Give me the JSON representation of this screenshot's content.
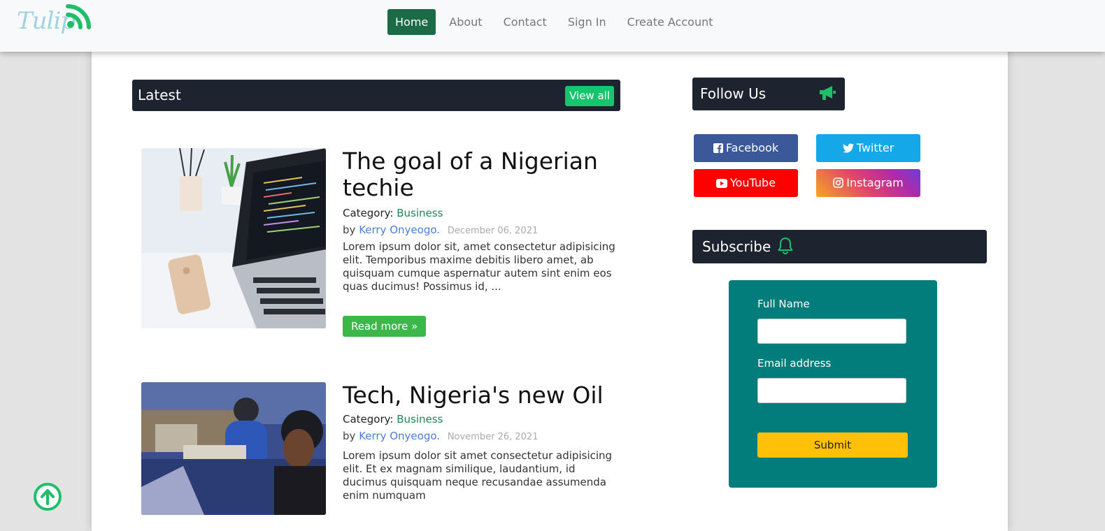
{
  "header": {
    "logo_text": "Tulip",
    "nav": [
      {
        "label": "Home",
        "active": true
      },
      {
        "label": "About",
        "active": false
      },
      {
        "label": "Contact",
        "active": false
      },
      {
        "label": "Sign In",
        "active": false
      },
      {
        "label": "Create Account",
        "active": false
      }
    ]
  },
  "latest": {
    "title": "Latest",
    "view_all": "View all"
  },
  "posts": [
    {
      "title": "The goal of a Nigerian techie",
      "category_label": "Category:",
      "category": "Business",
      "by": "by",
      "author": "Kerry Onyeogo.",
      "date": "December 06, 2021",
      "excerpt": "Lorem ipsum dolor sit, amet consectetur adipisicing elit. Temporibus maxime debitis libero amet, ab quisquam cumque aspernatur autem sint enim eos quas ducimus! Possimus id, ...",
      "read_more": "Read more »"
    },
    {
      "title": "Tech, Nigeria's new Oil",
      "category_label": "Category:",
      "category": "Business",
      "by": "by",
      "author": "Kerry Onyeogo.",
      "date": "November 26, 2021",
      "excerpt": "Lorem ipsum dolor sit amet consectetur adipisicing elit. Et ex magnam similique, laudantium, id ducimus quisquam neque recusandae assumenda enim numquam"
    }
  ],
  "follow": {
    "title": "Follow Us",
    "icon": "megaphone-icon",
    "buttons": [
      {
        "label": "Facebook",
        "icon": "facebook-icon",
        "color": "#3b5998"
      },
      {
        "label": "Twitter",
        "icon": "twitter-icon",
        "color": "#1da1f2"
      },
      {
        "label": "YouTube",
        "icon": "youtube-icon",
        "color": "#ff0000"
      },
      {
        "label": "Instagram",
        "icon": "instagram-icon",
        "color": "#c13584"
      }
    ]
  },
  "subscribe": {
    "title": "Subscribe",
    "icon": "bell-icon",
    "name_label": "Full Name",
    "name_value": "",
    "email_label": "Email address",
    "email_value": "",
    "submit": "Submit"
  },
  "colors": {
    "accent_green": "#16c56e",
    "dark_bar": "#1e2330",
    "teal_box": "#037d7b",
    "submit_yellow": "#ffc107"
  }
}
